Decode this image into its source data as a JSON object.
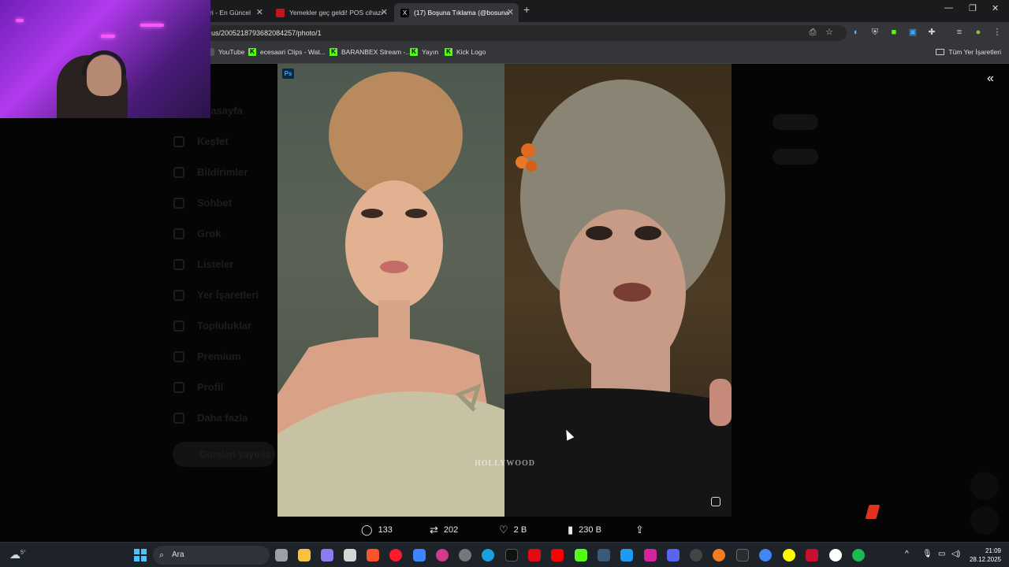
{
  "tabs": [
    {
      "label": "ri - En Güncel",
      "active": false
    },
    {
      "label": "Yemekler geç geldi! POS cihazı",
      "active": false
    },
    {
      "label": "(17) Boşuna Tıklama (@bosuna",
      "active": true
    }
  ],
  "address_bar": {
    "url": "us/2005218793682084257/photo/1"
  },
  "bookmarks": [
    {
      "label": "YouTube"
    },
    {
      "label": "ecesaari Clips - Wat..."
    },
    {
      "label": "BARANBEX Stream -..."
    },
    {
      "label": "Yayın"
    },
    {
      "label": "Kick Logo"
    }
  ],
  "bookmarks_right": {
    "label": "Tüm Yer İşaretleri"
  },
  "dim_nav": [
    "Anasayfa",
    "Keşfet",
    "Bildirimler",
    "Sohbet",
    "Grok",
    "Listeler",
    "Yer İşaretleri",
    "Topluluklar",
    "Premium",
    "Profil",
    "Daha fazla"
  ],
  "dim_post_button": "Gönderi yayınla",
  "photo": {
    "badge": "Ps",
    "watermark": "HOLLYWOOD"
  },
  "engagement": {
    "replies": "133",
    "reposts": "202",
    "likes": "2 B",
    "views": "230 B"
  },
  "taskbar": {
    "search_placeholder": "Ara",
    "weather": "5°",
    "time": "21:09",
    "date": "28.12.2025"
  },
  "colors": {
    "kick_green": "#53fc18",
    "webcam_purple": "#b23aee",
    "windows_blue": "#4cc2ff"
  }
}
